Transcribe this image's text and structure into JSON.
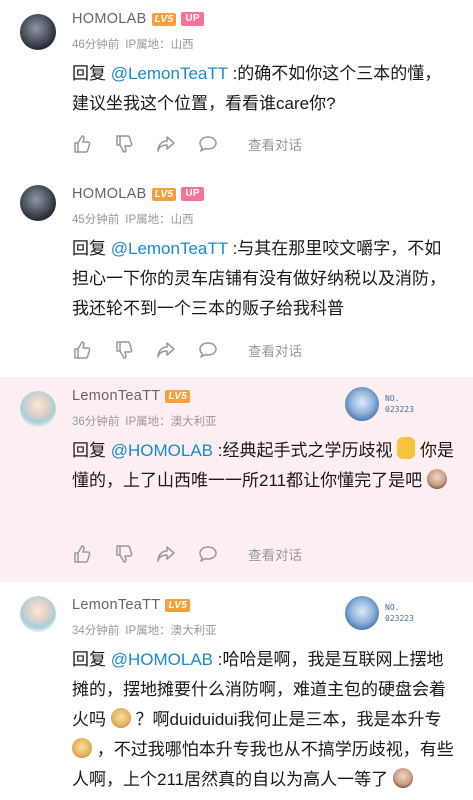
{
  "replies": [
    {
      "username": "HOMOLAB",
      "level": "LV5",
      "up_badge": "UP",
      "time": "46分钟前",
      "ip": "IP属地：山西",
      "prefix": "回复",
      "mention": "@LemonTeaTT",
      "text": ":的确不如你这个三本的懂，建议坐我这个位置，看看谁care你?",
      "view_conversation": "查看对话"
    },
    {
      "username": "HOMOLAB",
      "level": "LV5",
      "up_badge": "UP",
      "time": "45分钟前",
      "ip": "IP属地：山西",
      "prefix": "回复",
      "mention": "@LemonTeaTT",
      "text": ":与其在那里咬文嚼字，不如担心一下你的灵车店铺有没有做好纳税以及消防，我还轮不到一个三本的贩子给我科普",
      "view_conversation": "查看对话"
    },
    {
      "username": "LemonTeaTT",
      "level": "LV5",
      "time": "36分钟前",
      "ip": "IP属地：澳大利亚",
      "prefix": "回复",
      "mention": "@HOMOLAB",
      "text_a": ":经典起手式之学历歧视",
      "text_b": "你是懂的，上了山西唯一一所211都让你懂完了是吧",
      "badge_no": "NO.",
      "badge_num": "023223",
      "view_conversation": "查看对话"
    },
    {
      "username": "LemonTeaTT",
      "level": "LV5",
      "time": "34分钟前",
      "ip": "IP属地：澳大利亚",
      "prefix": "回复",
      "mention": "@HOMOLAB",
      "text_a": ":哈哈是啊，我是互联网上摆地摊的，摆地摊要什么消防啊，难道主包的硬盘会着火吗",
      "text_b": "？啊duiduidui我何止是三本，我是本升专",
      "text_c": "，不过我哪怕本升专我也从不搞学历歧视，有些人啊，上个211居然真的自以为高人一等了",
      "badge_no": "NO.",
      "badge_num": "023223"
    }
  ],
  "icons": [
    "like-icon",
    "dislike-icon",
    "share-icon",
    "comment-icon"
  ],
  "colors": {
    "mention": "#178bcf",
    "level": "#f6a03b",
    "up": "#fb7299",
    "highlight_bg": "#fdeff1"
  }
}
